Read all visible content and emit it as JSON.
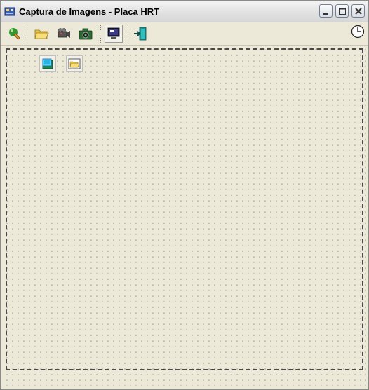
{
  "window": {
    "title": "Captura de Imagens - Placa HRT",
    "controls": [
      "minimize-icon",
      "maximize-icon",
      "close-icon"
    ]
  },
  "toolbar": {
    "buttons": [
      {
        "icon": "plugin-icon",
        "state": "normal"
      },
      {
        "icon": "open-folder-icon",
        "state": "normal"
      },
      {
        "icon": "video-camera-icon",
        "state": "normal"
      },
      {
        "icon": "photo-camera-icon",
        "state": "normal"
      },
      {
        "icon": "monitor-icon",
        "state": "pressed"
      },
      {
        "icon": "exit-door-icon",
        "state": "normal"
      }
    ],
    "timer_icon": "clock-icon"
  },
  "form_canvas": {
    "components": [
      {
        "icon": "image-component-icon"
      },
      {
        "icon": "open-dialog-component-icon"
      }
    ]
  },
  "colors": {
    "window_bg": "#ece9d8",
    "titlebar": "#e2e2e2",
    "grid_dot": "#6e6e6e"
  }
}
